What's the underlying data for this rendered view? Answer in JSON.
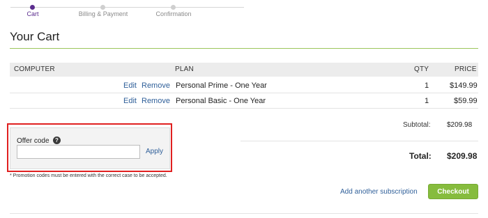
{
  "steps": [
    {
      "label": "Cart",
      "active": true
    },
    {
      "label": "Billing & Payment",
      "active": false
    },
    {
      "label": "Confirmation",
      "active": false
    }
  ],
  "page_title": "Your Cart",
  "table": {
    "headers": {
      "computer": "COMPUTER",
      "plan": "PLAN",
      "qty": "QTY",
      "price": "PRICE"
    },
    "rows": [
      {
        "edit": "Edit",
        "remove": "Remove",
        "plan": "Personal Prime - One Year",
        "qty": "1",
        "price": "$149.99"
      },
      {
        "edit": "Edit",
        "remove": "Remove",
        "plan": "Personal Basic - One Year",
        "qty": "1",
        "price": "$59.99"
      }
    ]
  },
  "totals": {
    "subtotal_label": "Subtotal:",
    "subtotal_value": "$209.98",
    "total_label": "Total:",
    "total_value": "$209.98"
  },
  "offer": {
    "label": "Offer code",
    "help_icon": "?",
    "input_value": "",
    "apply_label": "Apply",
    "promo_note": "* Promotion codes must be entered with the correct case to be accepted."
  },
  "actions": {
    "add_subscription": "Add another subscription",
    "checkout": "Checkout"
  },
  "colors": {
    "accent": "#5b2d8e",
    "link": "#2f5f99",
    "checkout": "#86bc3d",
    "highlight": "#e02020",
    "title_rule": "#9bc55a"
  }
}
